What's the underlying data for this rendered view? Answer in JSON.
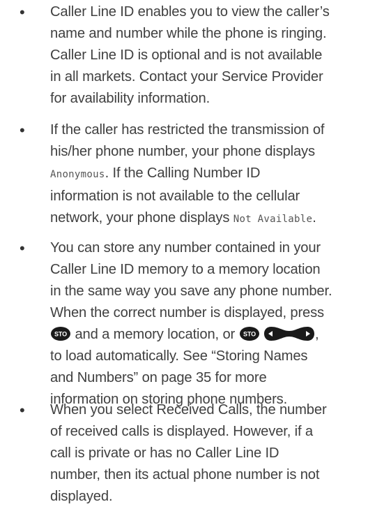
{
  "bullets": [
    {
      "lines": [
        "Caller Line ID enables you to view the caller’s",
        "name and number while the phone is ringing.",
        "Caller Line ID is optional and is not available",
        "in all markets. Contact your Service Provider",
        "for availability information."
      ]
    },
    {
      "line1": "If the caller has restricted the transmission of",
      "line2": "his/her phone number, your phone displays",
      "line3_display": "Anonymous",
      "line3_rest": ". If the Calling Number ID",
      "line4": "information is not available to the cellular",
      "line5_pre": "network, your phone displays ",
      "line5_display": "Not Available",
      "line5_post": "."
    },
    {
      "line1": "You can store any number contained in your",
      "line2": "Caller Line ID memory to a memory location",
      "line3": "in the same way you save any phone number.",
      "line4": "When the correct number is displayed, press",
      "line5_mid": " and a memory location, or ",
      "line5_post": ",",
      "line6": "to load automatically. See “Storing Names",
      "line7": "and Numbers” on page 35 for more",
      "line8": "information on storing phone numbers.",
      "sto_key_label": "STO",
      "key_icons": [
        "sto-key-icon",
        "scroll-key-icon"
      ]
    },
    {
      "lines": [
        "When you select Received Calls, the number",
        "of received calls is displayed. However, if a",
        "call is private or has no Caller Line ID",
        "number, then its actual phone number is not",
        "displayed."
      ]
    }
  ],
  "bullet_char": "•"
}
